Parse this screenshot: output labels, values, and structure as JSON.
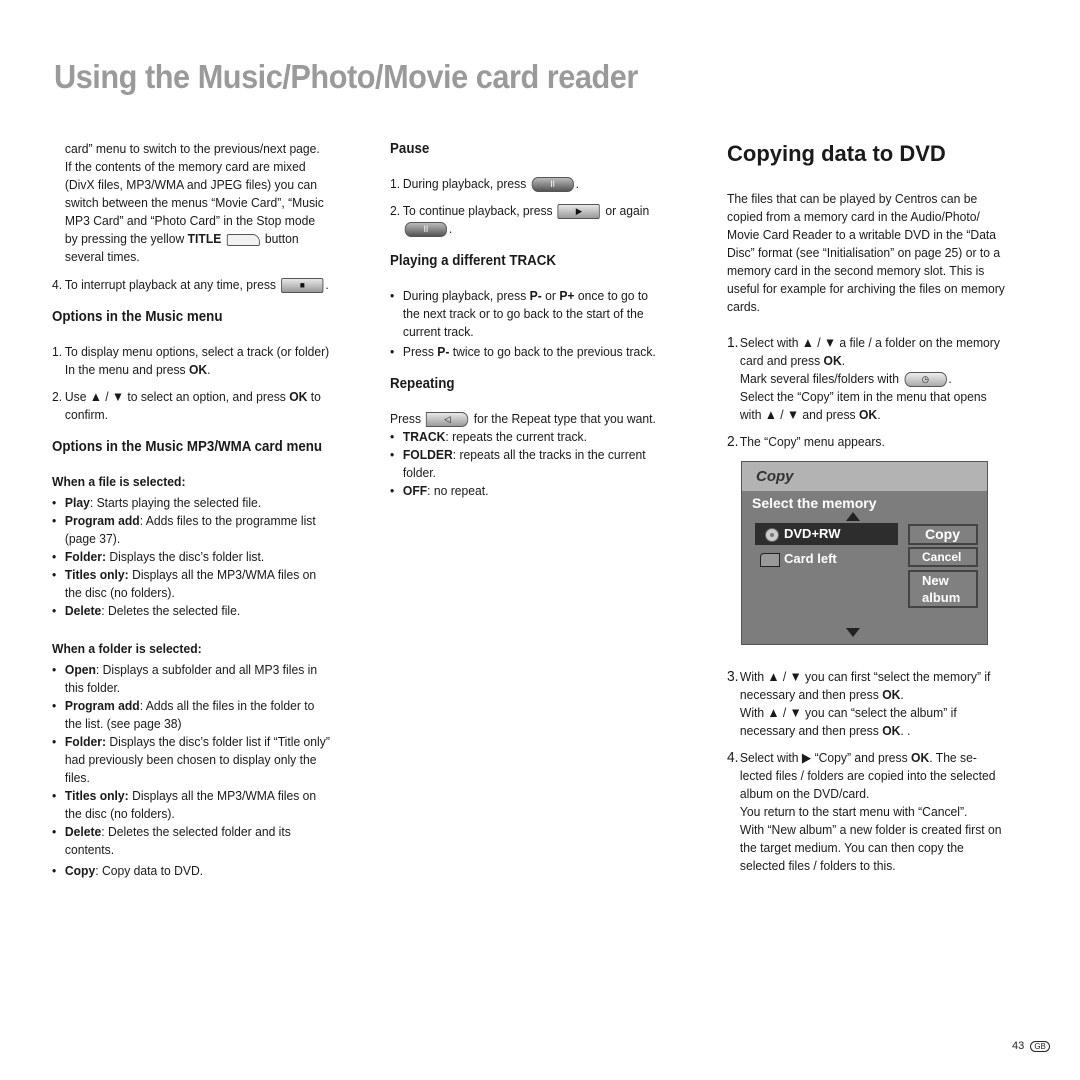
{
  "page_title": "Using the Music/Photo/Movie card reader",
  "col1": {
    "intro_lines": [
      "card” menu to switch to the previous/next page.",
      "If the contents of the memory card are mixed",
      "(DivX files, MP3/WMA and JPEG files) you can",
      "switch between the menus “Movie Card”, “Music",
      "MP3 Card” and “Photo Card” in the Stop mode"
    ],
    "intro_last_pre": "by pressing the yellow ",
    "intro_last_bold": "TITLE",
    "intro_last_post": " button",
    "intro_end": "several times.",
    "step4_num": "4.",
    "step4_text": "To interrupt playback at any time, press",
    "stop_key": "■",
    "music_menu_heading": "Options in the Music menu",
    "music_steps": [
      {
        "num": "1.",
        "pre": "To display menu options, select a track (or folder) In the menu and press ",
        "bold": "OK",
        "post": "."
      },
      {
        "num": "2.",
        "pre": "Use ▲ / ▼ to select an option, and press ",
        "bold": "OK",
        "post": " to confirm."
      }
    ],
    "mp3_heading": "Options in the Music MP3/WMA card menu",
    "file_selected_heading": "When a file is selected:",
    "file_items": [
      {
        "bold": "Play",
        "text": ": Starts playing the selected file."
      },
      {
        "bold": "Program add",
        "text": ": Adds files to the programme list (page 37)."
      },
      {
        "bold": "Folder:",
        "text": " Displays the disc’s folder list."
      },
      {
        "bold": "Titles only:",
        "text": " Displays all the MP3/WMA files on the disc (no folders)."
      },
      {
        "bold": "Delete",
        "text": ": Deletes the selected file."
      }
    ],
    "folder_selected_heading": "When a folder is selected:",
    "folder_items": [
      {
        "bold": "Open",
        "text": ": Displays a subfolder and all MP3 files in this folder."
      },
      {
        "bold": "Program add",
        "text": ": Adds all the files in the folder to the list. (see page 38)"
      },
      {
        "bold": "Folder:",
        "text": " Displays the disc’s folder list if “Title only” had previously been chosen to display only the files."
      },
      {
        "bold": "Titles only:",
        "text": " Displays all the MP3/WMA files on the disc (no folders)."
      },
      {
        "bold": "Delete",
        "text": ": Deletes the selected folder and its contents."
      },
      {
        "bold": "Copy",
        "text": ": Copy data to DVD."
      }
    ]
  },
  "col2": {
    "pause_heading": "Pause",
    "pause_step1_num": "1.",
    "pause_step1": "During playback, press",
    "pause_key": "II",
    "pause_step2_num": "2.",
    "pause_step2": "To continue playback, press",
    "play_key": "▶",
    "pause_step2_or": " or again",
    "track_heading": "Playing a different TRACK",
    "track_items": [
      {
        "pre": "During playback, press ",
        "b1": "P-",
        "mid": " or ",
        "b2": "P+",
        "post": " once to go to the next track or to go back to the start of the current track."
      },
      {
        "pre": "Press ",
        "b1": "P-",
        "mid": " twice to go back to the previous track.",
        "b2": "",
        "post": ""
      }
    ],
    "repeat_heading": "Repeating",
    "repeat_pre": "Press",
    "repeat_key": "◁",
    "repeat_post": "for the Repeat type that you want.",
    "repeat_items": [
      {
        "bold": "TRACK",
        "text": ": repeats the current track."
      },
      {
        "bold": "FOLDER",
        "text": ": repeats all the tracks in the current folder."
      },
      {
        "bold": "OFF",
        "text": ": no repeat."
      }
    ]
  },
  "col3": {
    "heading": "Copying data to DVD",
    "intro": "The files that can be played by Centros can be copied from a memory card in the Audio/Photo/ Movie Card Reader to a writable DVD in the “Data Disc” format (see “Initialisation” on page 25) or to a memory card in the second memory slot. This is useful for example for archiving the files on memory cards.",
    "step1_num": "1.",
    "step1_a": "Select with ▲ / ▼ a file / a folder on the memory card and press ",
    "step1_b": "Mark several files/folders with",
    "step1_c": "Select the “Copy” item in the menu that opens with ▲ / ▼ and press ",
    "ok": "OK",
    "clock_key": "◷",
    "step2_num": "2.",
    "step2": "The “Copy” menu appears.",
    "step3_num": "3.",
    "step3_a": "With ▲ / ▼ you can first “select the memory” if necessary and then press ",
    "step3_b": "With ▲ / ▼ you can “select the album” if necessary and then press ",
    "step3_b_end": ". .",
    "step4_num": "4.",
    "step4_a": "Select with ▶ “Copy” and press ",
    "step4_b": ". The se- lected files / folders are copied into the selected album on the DVD/card.",
    "step4_c": "You return to the start menu with “Cancel”.",
    "step4_d": "With “New album” a new folder is created first on the target medium. You can then copy the selected files / folders to this."
  },
  "osd": {
    "title": "Copy",
    "subtitle": "Select the memory",
    "memories": [
      "DVD+RW",
      "Card left"
    ],
    "selected_memory": "DVD+RW",
    "buttons": [
      "Copy",
      "Cancel",
      "New album"
    ]
  },
  "footer": {
    "page_number": "43",
    "lang_badge": "GB"
  }
}
